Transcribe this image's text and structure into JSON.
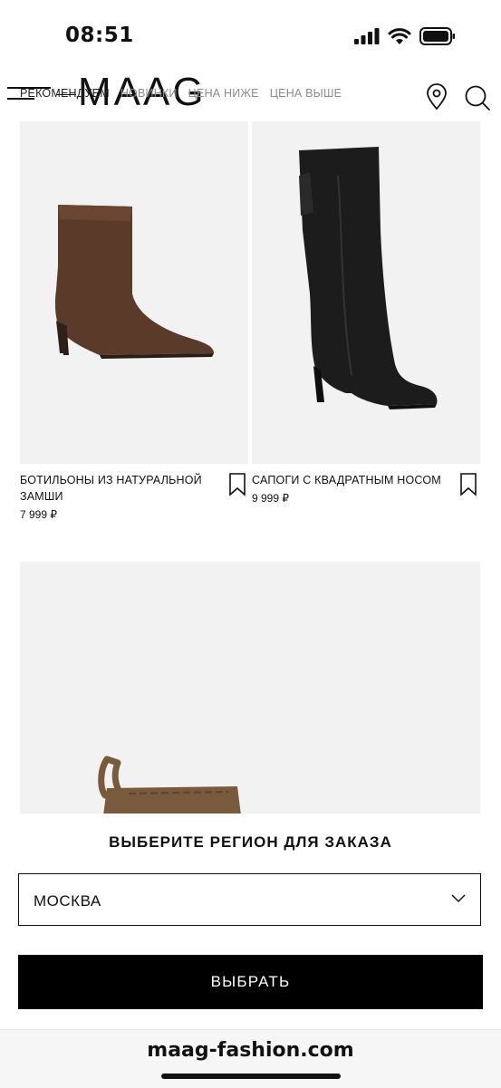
{
  "status": {
    "time": "08:51"
  },
  "header": {
    "logo": "MAAG",
    "sorts": [
      {
        "label": "РЕКОМЕНДУЕМ",
        "active": true
      },
      {
        "label": "НОВИНКИ",
        "active": false
      },
      {
        "label": "ЦЕНА НИЖЕ",
        "active": false
      },
      {
        "label": "ЦЕНА ВЫШЕ",
        "active": false
      }
    ]
  },
  "products": [
    {
      "title": "БОТИЛЬОНЫ ИЗ НАТУРАЛЬНОЙ ЗАМШИ",
      "price": "7 999 ₽"
    },
    {
      "title": "САПОГИ С КВАДРАТНЫМ НОСОМ",
      "price": "9 999 ₽"
    }
  ],
  "region_sheet": {
    "title": "ВЫБЕРИТЕ РЕГИОН ДЛЯ ЗАКАЗА",
    "selected_region": "МОСКВА",
    "button_label": "ВЫБРАТЬ"
  },
  "browser": {
    "url": "maag-fashion.com"
  },
  "colors": {
    "image_bg": "#f2f2f2",
    "button_bg": "#000000",
    "suede": "#5a3b2a",
    "leather": "#1c1c1c"
  }
}
